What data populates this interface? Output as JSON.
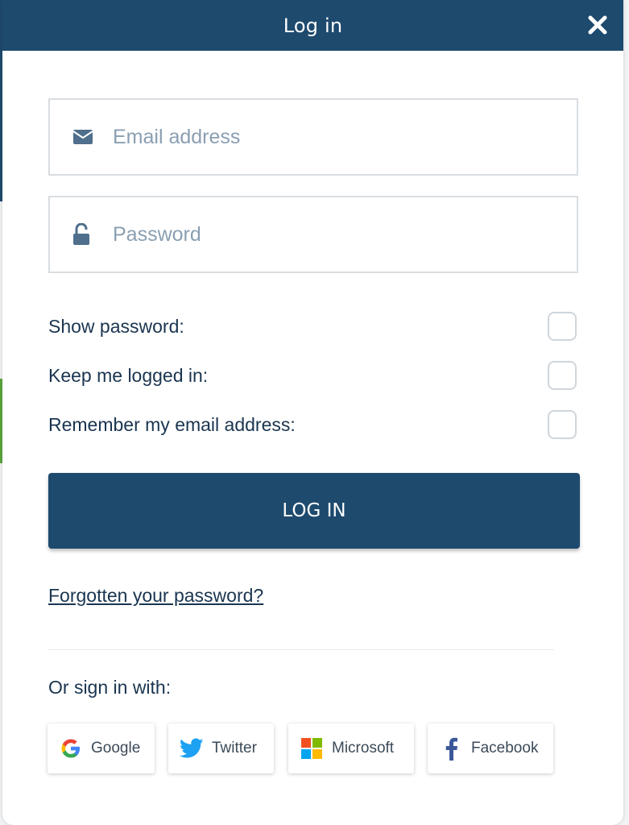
{
  "modal": {
    "title": "Log in",
    "close_icon": "close-icon"
  },
  "form": {
    "email": {
      "placeholder": "Email address",
      "value": "",
      "icon": "envelope-icon"
    },
    "password": {
      "placeholder": "Password",
      "value": "",
      "icon": "unlocked-padlock-icon"
    }
  },
  "options": [
    {
      "label": "Show password:",
      "checked": false
    },
    {
      "label": "Keep me logged in:",
      "checked": false
    },
    {
      "label": "Remember my email address:",
      "checked": false
    }
  ],
  "login_button": {
    "label": "LOG IN"
  },
  "forgot_link": {
    "label": "Forgotten your password?"
  },
  "social": {
    "heading": "Or sign in with:",
    "providers": [
      {
        "label": "Google",
        "icon": "google-icon"
      },
      {
        "label": "Twitter",
        "icon": "twitter-icon"
      },
      {
        "label": "Microsoft",
        "icon": "microsoft-icon"
      },
      {
        "label": "Facebook",
        "icon": "facebook-icon"
      }
    ]
  },
  "colors": {
    "primary": "#1e4a6e",
    "text": "#1a3550",
    "placeholder": "#8a9fb2",
    "border": "#d9dde1"
  }
}
